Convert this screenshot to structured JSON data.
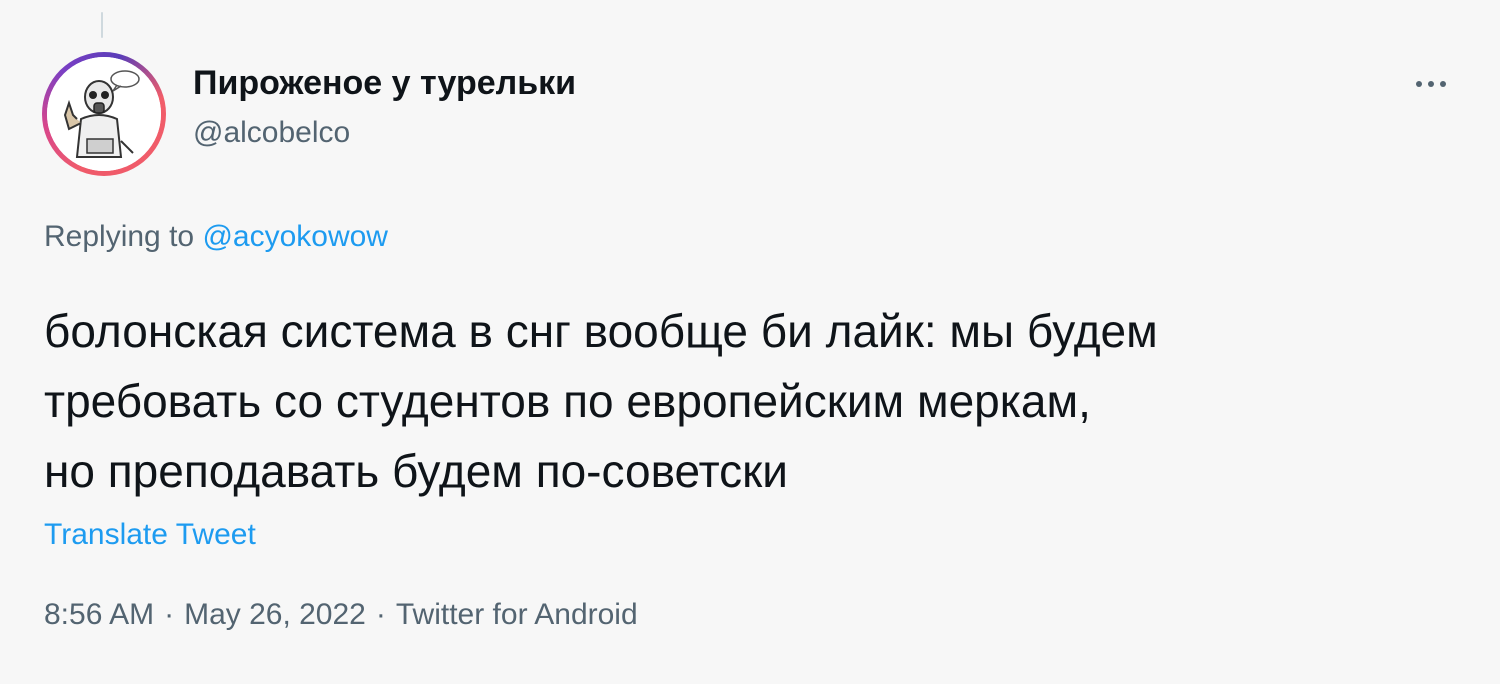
{
  "author": {
    "display_name": "Пироженое у турельки",
    "handle": "@alcobelco"
  },
  "reply": {
    "prefix": "Replying to ",
    "to_handle": "@acyokowow"
  },
  "tweet": {
    "lines": [
      "болонская система в снг вообще би лайк: мы будем",
      "требовать со студентов по европейским меркам,",
      "но преподавать будем по-советски"
    ],
    "translate_label": "Translate Tweet",
    "time": "8:56 AM",
    "date": "May 26, 2022",
    "source": "Twitter for Android",
    "separator": "·"
  },
  "icons": {
    "more": "more-horizontal-icon",
    "avatar": "gas-mask-figure-avatar"
  },
  "colors": {
    "background": "#f7f7f7",
    "text": "#0f1419",
    "secondary": "#536471",
    "link": "#1d9bf0"
  }
}
